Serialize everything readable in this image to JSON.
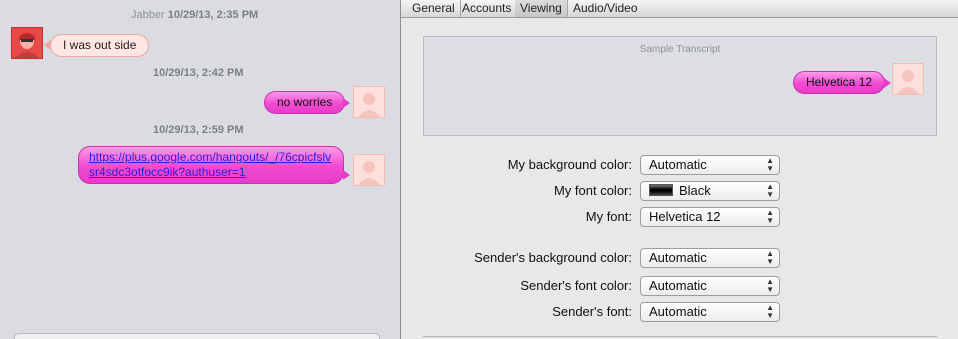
{
  "chat": {
    "header_name": "Jabber",
    "header_time": "10/29/13, 2:35 PM",
    "messages": [
      {
        "direction": "incoming",
        "text": "I was out side"
      },
      {
        "timestamp": "10/29/13, 2:42 PM"
      },
      {
        "direction": "outgoing",
        "text": "no worries"
      },
      {
        "timestamp": "10/29/13, 2:59 PM"
      },
      {
        "direction": "outgoing",
        "link_line1": "https://plus.google.com/hangouts/_/76cpicfslv",
        "link_line2": "sr4sdc3otfocc9ik?authuser=1"
      }
    ]
  },
  "prefs": {
    "tabs": [
      "General",
      "Accounts",
      "Viewing",
      "Audio/Video"
    ],
    "active_tab": "Viewing",
    "sample": {
      "title": "Sample Transcript",
      "message": "Helvetica 12"
    },
    "rows": [
      {
        "label": "My background color:",
        "value": "Automatic"
      },
      {
        "label": "My font color:",
        "value": "Black",
        "swatch": "#000000"
      },
      {
        "label": "My font:",
        "value": "Helvetica 12"
      },
      {
        "label": "Sender's background color:",
        "value": "Automatic"
      },
      {
        "label": "Sender's font color:",
        "value": "Automatic"
      },
      {
        "label": "Sender's font:",
        "value": "Automatic"
      }
    ]
  },
  "colors": {
    "outgoing_bubble": "#f04ad2",
    "incoming_bubble": "#fde6e3",
    "link": "#2c1fd6",
    "chat_background": "#dadce2"
  },
  "icons": [
    "buddy-avatar-icon",
    "self-avatar-icon",
    "popup-arrows-icon",
    "color-swatch-icon"
  ]
}
